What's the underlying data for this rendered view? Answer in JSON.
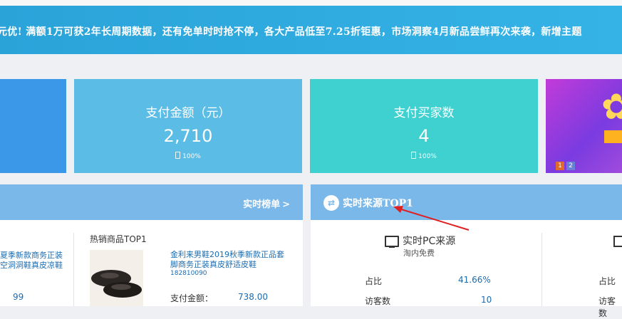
{
  "banner": {
    "text": "元优!  满额1万可获2年长周期数据，还有免单时时抢不停，各大产品低至7.25折钜惠，市场洞察4月新品尝鲜再次来袭，新增主题"
  },
  "cards": {
    "amount": {
      "title": "支付金额（元）",
      "value": "2,710",
      "sub": "100%"
    },
    "buyers": {
      "title": "支付买家数",
      "value": "4",
      "sub": "100%"
    }
  },
  "promo": {
    "pages": [
      "1",
      "2"
    ],
    "active_page": "1"
  },
  "left_panel": {
    "link_label": "实时榜单",
    "chevron": ">",
    "prev_product": {
      "name": "夏季新款商务正装空洞洞鞋真皮凉鞋",
      "number": "99"
    },
    "hot": {
      "title": "热销商品TOP1",
      "product_name": "金利来男鞋2019秋季新款正品套脚商务正装真皮舒适皮鞋",
      "product_id": "182810090",
      "pay_label": "支付金额：",
      "pay_value": "738.00"
    }
  },
  "right_panel": {
    "title": "实时来源TOP1",
    "icon": "refresh-icon",
    "source": {
      "title": "实时PC来源",
      "subtitle": "淘内免费"
    },
    "rows": [
      {
        "label": "占比",
        "value": "41.66%"
      },
      {
        "label": "访客数",
        "value": "10"
      }
    ],
    "second_column": {
      "rows": [
        {
          "label": "占比"
        },
        {
          "label": "访客数"
        }
      ]
    }
  },
  "colors": {
    "banner": "#2aa3d9",
    "card_amount": "#5bbde5",
    "card_buyers": "#3fd0d0",
    "panel_head": "#7ab8ea",
    "link": "#1b6bb0",
    "annotation_arrow": "#e02020"
  }
}
